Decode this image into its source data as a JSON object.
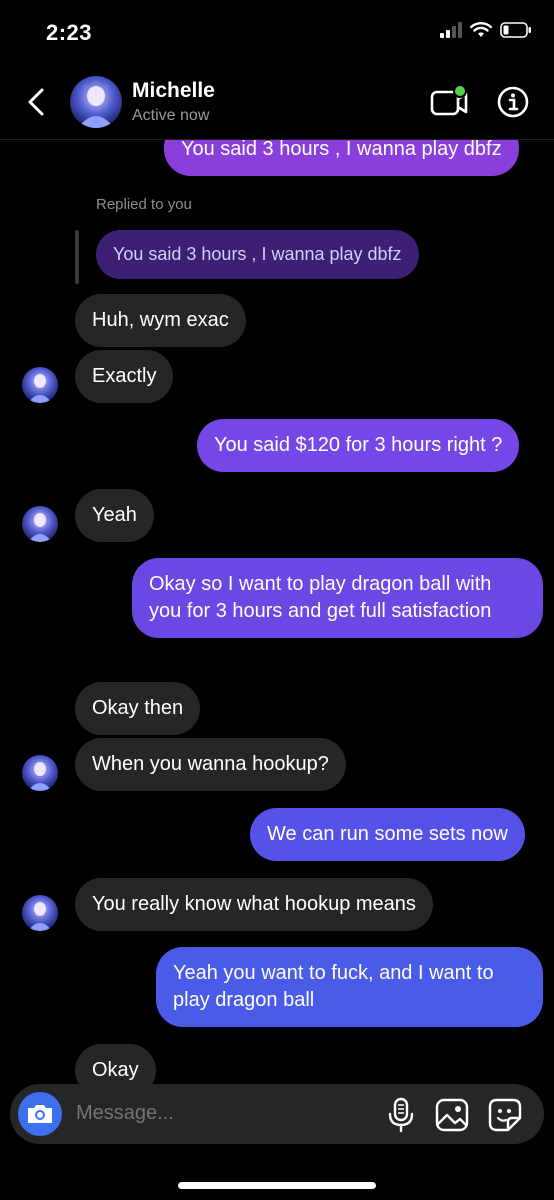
{
  "status": {
    "time": "2:23"
  },
  "header": {
    "name": "Michelle",
    "status": "Active now"
  },
  "reply": {
    "label": "Replied to you",
    "quote": "You said 3 hours , I wanna play dbfz"
  },
  "messages": [
    {
      "side": "out",
      "text": "You said 3 hours , I wanna play dbfz"
    },
    {
      "side": "in",
      "text": "Huh, wym exac"
    },
    {
      "side": "in",
      "text": "Exactly"
    },
    {
      "side": "out",
      "text": "You said $120 for 3 hours right ?"
    },
    {
      "side": "in",
      "text": "Yeah"
    },
    {
      "side": "out",
      "text": "Okay so I want to play dragon ball with you for 3 hours and get full satisfaction"
    },
    {
      "side": "in",
      "text": "Okay then"
    },
    {
      "side": "in",
      "text": "When you wanna hookup?"
    },
    {
      "side": "out",
      "text": "We can run some sets now"
    },
    {
      "side": "in",
      "text": "You really know what hookup means"
    },
    {
      "side": "out",
      "text": "Yeah you want to fuck, and I want to play dragon ball"
    },
    {
      "side": "in",
      "text": "Okay"
    }
  ],
  "composer": {
    "placeholder": "Message..."
  },
  "colors": {
    "accent": "#3d6ff0",
    "purple_top": "#8a3fdc",
    "blue_bottom": "#4a5be8",
    "incoming": "#262626",
    "online": "#55d14a"
  },
  "icons": [
    "back-icon",
    "video-call-icon",
    "info-icon",
    "camera-icon",
    "microphone-icon",
    "gallery-icon",
    "sticker-icon"
  ]
}
